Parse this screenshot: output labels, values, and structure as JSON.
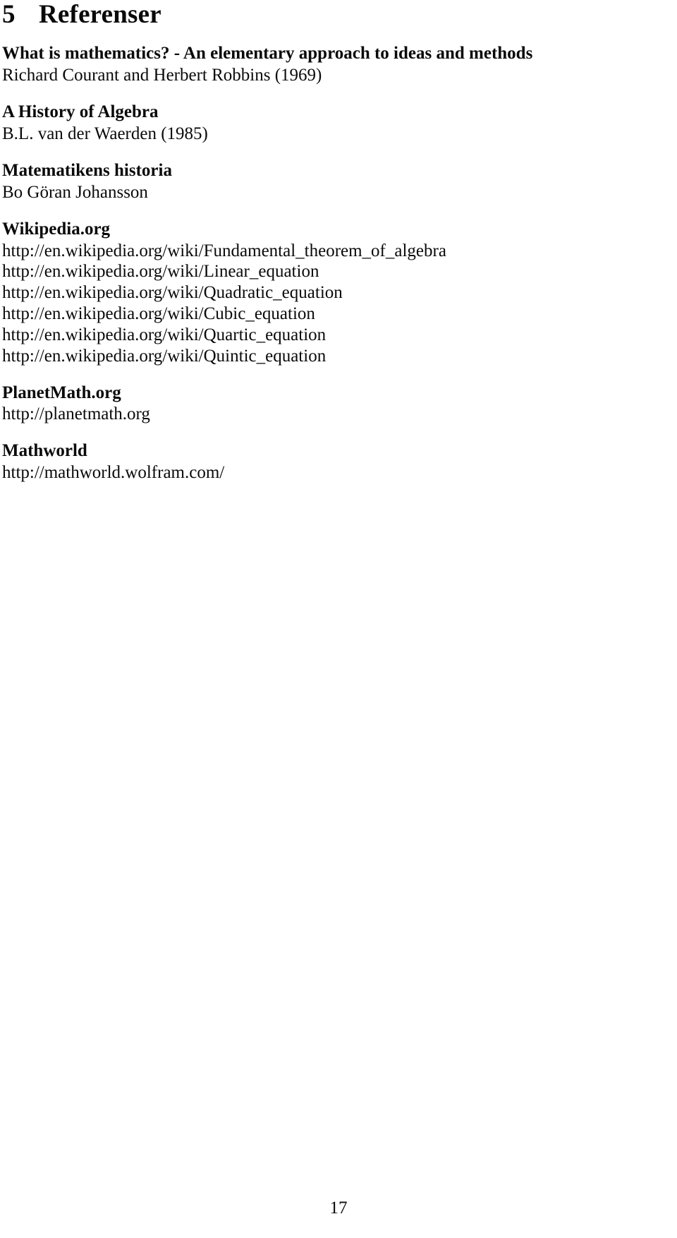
{
  "section": {
    "number": "5",
    "title": "Referenser"
  },
  "references": [
    {
      "title": "What is mathematics? - An elementary approach to ideas and methods",
      "subtitle": "Richard Courant and Herbert Robbins (1969)"
    },
    {
      "title": "A History of Algebra",
      "subtitle": "B.L. van der Waerden (1985)"
    },
    {
      "title": "Matematikens historia",
      "subtitle": "Bo Göran Johansson"
    }
  ],
  "wikipedia": {
    "title": "Wikipedia.org",
    "urls": [
      "http://en.wikipedia.org/wiki/Fundamental_theorem_of_algebra",
      "http://en.wikipedia.org/wiki/Linear_equation",
      "http://en.wikipedia.org/wiki/Quadratic_equation",
      "http://en.wikipedia.org/wiki/Cubic_equation",
      "http://en.wikipedia.org/wiki/Quartic_equation",
      "http://en.wikipedia.org/wiki/Quintic_equation"
    ]
  },
  "planetmath": {
    "title": "PlanetMath.org",
    "urls": [
      "http://planetmath.org"
    ]
  },
  "mathworld": {
    "title": "Mathworld",
    "urls": [
      "http://mathworld.wolfram.com/"
    ]
  },
  "footer": {
    "page_number": "17"
  }
}
